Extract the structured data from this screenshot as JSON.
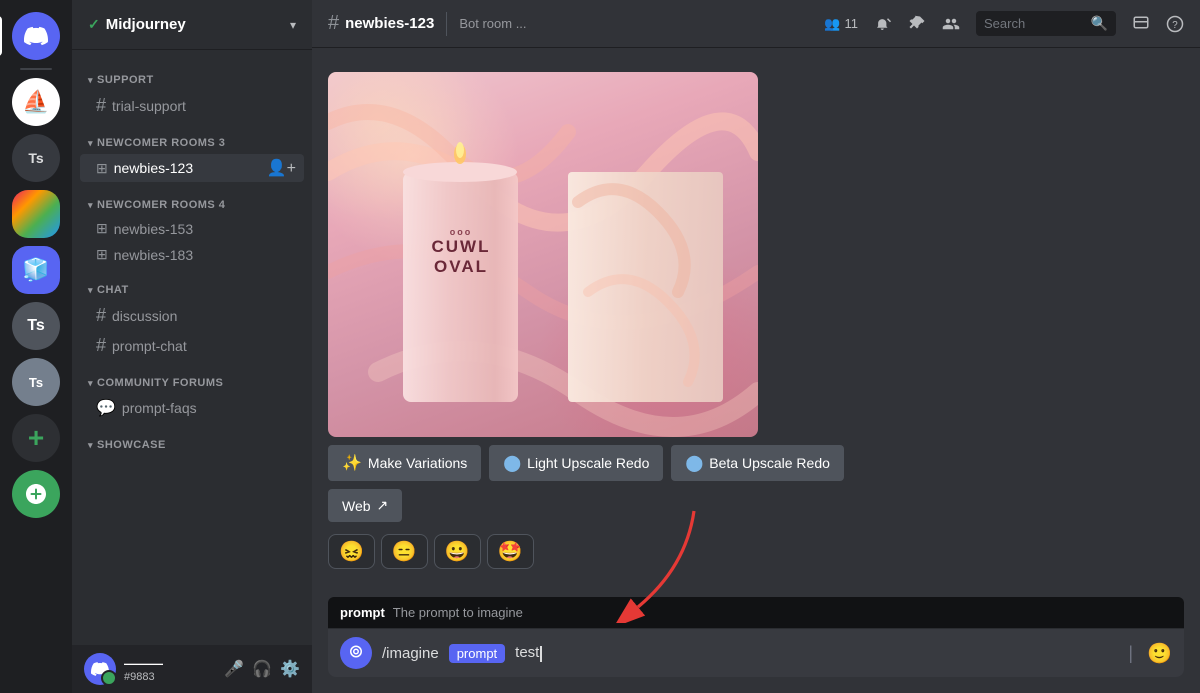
{
  "server_sidebar": {
    "icons": [
      {
        "id": "discord",
        "label": "Discord Home",
        "symbol": "✦",
        "style": "discord-home"
      },
      {
        "id": "sail",
        "label": "Sail Server",
        "symbol": "⛵",
        "style": "sail"
      },
      {
        "id": "ts1",
        "label": "Ts Server 1",
        "symbol": "Ts",
        "style": "ts-icon"
      },
      {
        "id": "colorful",
        "label": "Colorful Server",
        "symbol": "",
        "style": "colorful"
      },
      {
        "id": "purple",
        "label": "Purple Server",
        "symbol": "",
        "style": "purple"
      },
      {
        "id": "t",
        "label": "T Server",
        "symbol": "T",
        "style": "t-icon"
      },
      {
        "id": "ts2",
        "label": "Ts Server 2",
        "symbol": "Ts",
        "style": "ts2-icon"
      },
      {
        "id": "add",
        "label": "Add Server",
        "symbol": "+",
        "style": "add-icon"
      },
      {
        "id": "green",
        "label": "Green Server",
        "symbol": "",
        "style": "green-circle"
      }
    ]
  },
  "channel_sidebar": {
    "server_name": "Midjourney",
    "checkmark": "✓",
    "categories": [
      {
        "name": "SUPPORT",
        "channels": [
          {
            "name": "trial-support",
            "prefix": "#",
            "type": "text"
          }
        ]
      },
      {
        "name": "NEWCOMER ROOMS 3",
        "channels": [
          {
            "name": "newbies-123",
            "prefix": "#",
            "type": "text",
            "active": true
          }
        ]
      },
      {
        "name": "NEWCOMER ROOMS 4",
        "channels": [
          {
            "name": "newbies-153",
            "prefix": "#",
            "type": "text"
          },
          {
            "name": "newbies-183",
            "prefix": "#",
            "type": "text"
          }
        ]
      },
      {
        "name": "CHAT",
        "channels": [
          {
            "name": "discussion",
            "prefix": "#",
            "type": "text"
          },
          {
            "name": "prompt-chat",
            "prefix": "#",
            "type": "text"
          }
        ]
      },
      {
        "name": "COMMUNITY FORUMS",
        "channels": [
          {
            "name": "prompt-faqs",
            "prefix": "💬",
            "type": "forum"
          }
        ]
      },
      {
        "name": "SHOWCASE",
        "channels": []
      }
    ],
    "footer": {
      "username": "———",
      "discriminator": "#9883",
      "avatar_text": ""
    }
  },
  "topbar": {
    "channel_name": "newbies-123",
    "description": "Bot room ...",
    "members_count": "11",
    "search_placeholder": "Search"
  },
  "message": {
    "candle_brand": "CUWL",
    "candle_subtitle": "OVAL",
    "candle_dots": "ooo"
  },
  "action_buttons": {
    "make_variations": "Make Variations",
    "make_variations_icon": "✨",
    "light_upscale_redo": "Light Upscale Redo",
    "light_upscale_icon": "🔵",
    "beta_upscale_redo": "Beta Upscale Redo",
    "beta_upscale_icon": "🔵",
    "web": "Web",
    "web_icon": "↗"
  },
  "emoji_reactions": [
    "😖",
    "😑",
    "😀",
    "🤩"
  ],
  "input_tooltip": {
    "label": "prompt",
    "description": "The prompt to imagine"
  },
  "input_bar": {
    "slash_command": "/imagine",
    "prompt_tag": "prompt",
    "input_text": "test",
    "cursor_symbol": "I"
  }
}
